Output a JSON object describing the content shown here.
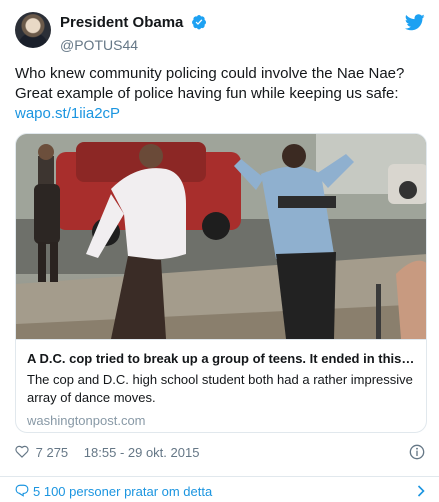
{
  "user": {
    "display_name": "President Obama",
    "handle": "@POTUS44"
  },
  "tweet": {
    "text_line1": "Who knew community policing could involve the Nae Nae?",
    "text_line2": "Great example of police having fun while keeping us safe:",
    "link": "wapo.st/1iia2cP"
  },
  "card": {
    "title": "A D.C. cop tried to break up a group of teens. It ended in this i…",
    "description": "The cop and D.C. high school student both had a rather impressive array of dance moves.",
    "domain": "washingtonpost.com"
  },
  "meta": {
    "likes": "7 275",
    "timestamp": "18:55 - 29 okt. 2015"
  },
  "footer": {
    "label": "5 100 personer pratar om detta"
  },
  "colors": {
    "link": "#1b95e0",
    "muted": "#657786",
    "verified": "#1da1f2",
    "border": "#e1e8ed"
  },
  "icons": [
    "verified-badge-icon",
    "twitter-bird-icon",
    "heart-icon",
    "info-icon",
    "reply-icon",
    "chevron-right-icon"
  ]
}
